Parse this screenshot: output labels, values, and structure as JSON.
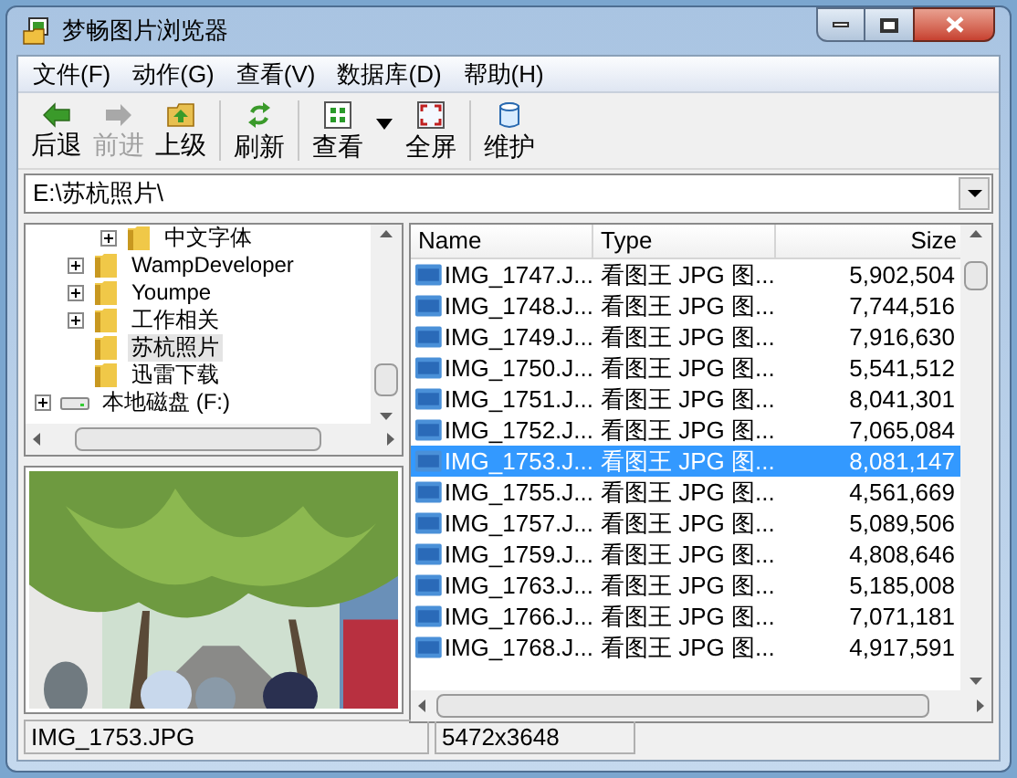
{
  "window": {
    "title": "梦畅图片浏览器"
  },
  "menu": [
    "文件(F)",
    "动作(G)",
    "查看(V)",
    "数据库(D)",
    "帮助(H)"
  ],
  "toolbar": [
    {
      "kind": "back",
      "label": "后退",
      "disabled": false
    },
    {
      "kind": "forward",
      "label": "前进",
      "disabled": true
    },
    {
      "kind": "up",
      "label": "上级",
      "disabled": false
    },
    {
      "kind": "separator"
    },
    {
      "kind": "refresh",
      "label": "刷新",
      "disabled": false
    },
    {
      "kind": "separator"
    },
    {
      "kind": "view",
      "label": "查看",
      "disabled": false
    },
    {
      "kind": "dropdown"
    },
    {
      "kind": "fullscreen",
      "label": "全屏",
      "disabled": false
    },
    {
      "kind": "separator"
    },
    {
      "kind": "database",
      "label": "维护",
      "disabled": false
    }
  ],
  "address": {
    "value": "E:\\苏杭照片\\"
  },
  "tree": [
    {
      "kind": "hidden",
      "children": [
        {
          "kind": "hidden",
          "children": [
            {
              "kind": "folder",
              "label": "中文字体",
              "expandable": true,
              "selected": false
            }
          ]
        },
        {
          "kind": "folder",
          "label": "WampDeveloper",
          "expandable": true,
          "selected": false
        },
        {
          "kind": "folder",
          "label": "Youmpe",
          "expandable": true,
          "selected": false
        },
        {
          "kind": "folder",
          "label": "工作相关",
          "expandable": true,
          "selected": false
        },
        {
          "kind": "folder",
          "label": "苏杭照片",
          "expandable": false,
          "selected": true
        },
        {
          "kind": "folder",
          "label": "迅雷下载",
          "expandable": false,
          "selected": false
        }
      ]
    },
    {
      "kind": "drive",
      "label": "本地磁盘 (F:)",
      "expandable": true,
      "selected": false
    }
  ],
  "preview": {
    "kind": "picture"
  },
  "table": {
    "columns": [
      "Name",
      "Type",
      "Size"
    ],
    "rows": [
      {
        "name": "IMG_1747.J...",
        "type": "看图王 JPG 图...",
        "size": "5,902,504",
        "selected": false
      },
      {
        "name": "IMG_1748.J...",
        "type": "看图王 JPG 图...",
        "size": "7,744,516",
        "selected": false
      },
      {
        "name": "IMG_1749.J...",
        "type": "看图王 JPG 图...",
        "size": "7,916,630",
        "selected": false
      },
      {
        "name": "IMG_1750.J...",
        "type": "看图王 JPG 图...",
        "size": "5,541,512",
        "selected": false
      },
      {
        "name": "IMG_1751.J...",
        "type": "看图王 JPG 图...",
        "size": "8,041,301",
        "selected": false
      },
      {
        "name": "IMG_1752.J...",
        "type": "看图王 JPG 图...",
        "size": "7,065,084",
        "selected": false
      },
      {
        "name": "IMG_1753.J...",
        "type": "看图王 JPG 图...",
        "size": "8,081,147",
        "selected": true
      },
      {
        "name": "IMG_1755.J...",
        "type": "看图王 JPG 图...",
        "size": "4,561,669",
        "selected": false
      },
      {
        "name": "IMG_1757.J...",
        "type": "看图王 JPG 图...",
        "size": "5,089,506",
        "selected": false
      },
      {
        "name": "IMG_1759.J...",
        "type": "看图王 JPG 图...",
        "size": "4,808,646",
        "selected": false
      },
      {
        "name": "IMG_1763.J...",
        "type": "看图王 JPG 图...",
        "size": "5,185,008",
        "selected": false
      },
      {
        "name": "IMG_1766.J...",
        "type": "看图王 JPG 图...",
        "size": "7,071,181",
        "selected": false
      },
      {
        "name": "IMG_1768.J...",
        "type": "看图王 JPG 图...",
        "size": "4,917,591",
        "selected": false
      }
    ]
  },
  "status_bar": [
    "IMG_1753.JPG",
    "5472x3648"
  ]
}
